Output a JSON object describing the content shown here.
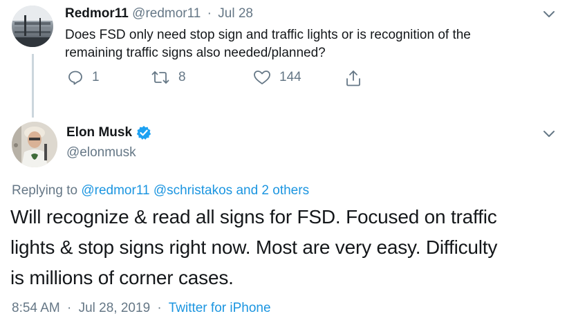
{
  "reply_tweet": {
    "display_name": "Redmor11",
    "handle": "@redmor11",
    "separator": "·",
    "date": "Jul 28",
    "text_line1": "Does FSD only need stop sign and traffic lights or is recognition of the",
    "text_line2": "remaining traffic signs also needed/planned?",
    "actions": {
      "reply_count": "1",
      "retweet_count": "8",
      "like_count": "144"
    },
    "icons": [
      "reply-icon",
      "retweet-icon",
      "like-icon",
      "share-icon",
      "chevron-down-icon"
    ]
  },
  "main_tweet": {
    "display_name": "Elon Musk",
    "handle": "@elonmusk",
    "replying_prefix": "Replying to",
    "replying_users": [
      "@redmor11",
      "@schristakos"
    ],
    "replying_and": "and",
    "replying_others": "2 others",
    "text_line1": "Will recognize & read all signs for FSD. Focused on traffic",
    "text_line2": "lights & stop signs right now. Most are very easy. Difficulty",
    "text_line3": "is millions of corner cases.",
    "time": "8:54 AM",
    "separator": "·",
    "date": "Jul 28, 2019",
    "separator2": "·",
    "source": "Twitter for iPhone",
    "icons": [
      "verified-badge-icon",
      "chevron-down-icon"
    ]
  },
  "colors": {
    "link": "#1b95e0",
    "muted": "#657786",
    "text": "#14171a",
    "thread_line": "#ccd6dd",
    "verified": "#1da1f2"
  }
}
